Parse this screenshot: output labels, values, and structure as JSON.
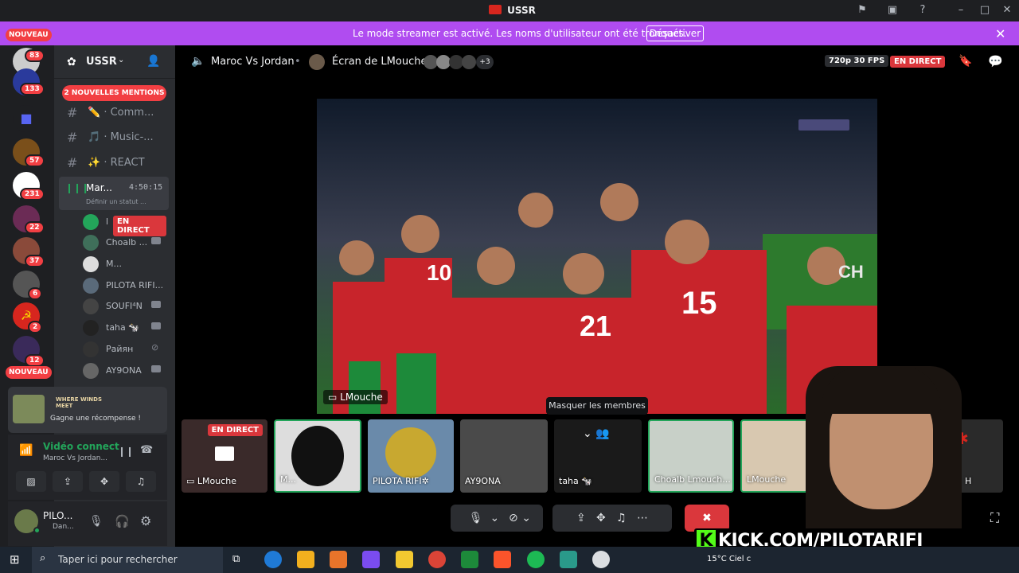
{
  "window": {
    "title": "USSR"
  },
  "banner": {
    "message": "Le mode streamer est activé. Les noms d'utilisateur ont été tronqués.",
    "button": "Désactiver"
  },
  "rail": {
    "new_top": "NOUVEAU",
    "new_bottom": "NOUVEAU",
    "badges": [
      "83",
      "133",
      "57",
      "231",
      "22",
      "37",
      "6",
      "2",
      "12"
    ]
  },
  "server": {
    "name": "USSR",
    "mentions": "2 NOUVELLES MENTIONS"
  },
  "channels": [
    {
      "label": "· Comm...",
      "icon": "✏️"
    },
    {
      "label": "· Music-...",
      "icon": "🎵"
    },
    {
      "label": "· REACT",
      "icon": "✨"
    }
  ],
  "voice_channel": {
    "name": "Mar...",
    "timer": "4:50:15",
    "status_placeholder": "Définir un statut ..."
  },
  "members": [
    {
      "name": "l",
      "live": "EN DIRECT"
    },
    {
      "name": "Choalb ..."
    },
    {
      "name": "M..."
    },
    {
      "name": "PILOTA RIFI..."
    },
    {
      "name": "SOUFI⁴N"
    },
    {
      "name": "taha 🐄"
    },
    {
      "name": "Райян"
    },
    {
      "name": "AY9ONA"
    }
  ],
  "promo": {
    "brand": "WHERE WINDS MEET",
    "text": "Gagne une récompense !"
  },
  "voice_status": {
    "title": "Vidéo connect",
    "subtitle": "Maroc Vs Jordan..."
  },
  "user": {
    "name": "PILO...",
    "status": "Dan..."
  },
  "call": {
    "channel": "Maroc Vs Jordan",
    "screen_owner": "Écran de LMouche",
    "extra": "+3",
    "quality": "720p 30 FPS",
    "live": "EN DIRECT",
    "stream_label": "LMouche"
  },
  "tooltip": "Masquer les membres",
  "tiles": [
    {
      "label": "LMouche",
      "live": "EN DIRECT"
    },
    {
      "label": "M..."
    },
    {
      "label": "PILOTA RIFI✲"
    },
    {
      "label": "AY9ONA"
    },
    {
      "label": "taha 🐄"
    },
    {
      "label": "Choalb Lmouch..."
    },
    {
      "label": "LMouche"
    },
    {
      "label": "H"
    }
  ],
  "overlay": {
    "kick": "KICK.COM/PILOTARIFI"
  },
  "taskbar": {
    "search": "Taper ici pour rechercher",
    "weather": "15°C Ciel c"
  },
  "colors": {
    "accent": "#b04cf0",
    "live": "#da373c",
    "mention": "#f23f43",
    "green": "#23a55a",
    "kick": "#53fc18"
  }
}
